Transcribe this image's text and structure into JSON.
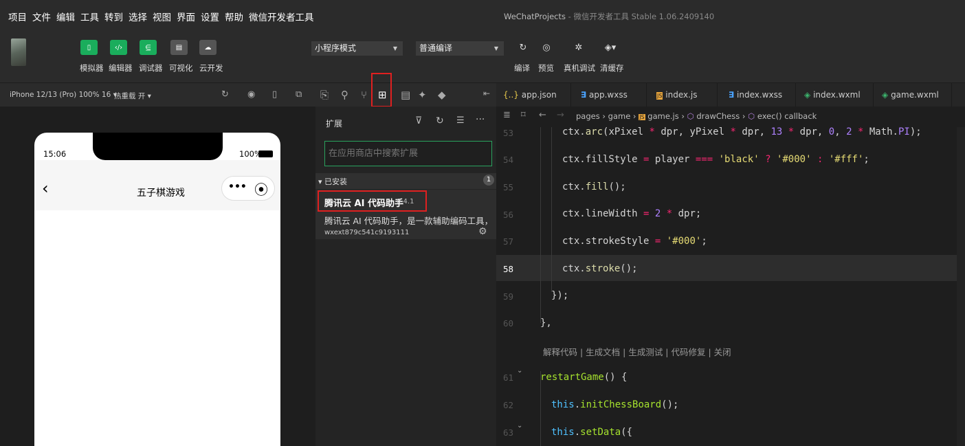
{
  "menu": [
    "项目",
    "文件",
    "编辑",
    "工具",
    "转到",
    "选择",
    "视图",
    "界面",
    "设置",
    "帮助",
    "微信开发者工具"
  ],
  "window_title": "WeChatProjects",
  "window_title_sub": " - 微信开发者工具 Stable 1.06.2409140",
  "toolbar": {
    "btns": [
      {
        "label": "模拟器",
        "icon": "phone-icon"
      },
      {
        "label": "编辑器",
        "icon": "code-icon"
      },
      {
        "label": "调试器",
        "icon": "debug-icon"
      },
      {
        "label": "可视化",
        "icon": "layout-icon"
      },
      {
        "label": "云开发",
        "icon": "cloud-icon"
      }
    ],
    "mode": "小程序模式",
    "compile": "普通编译",
    "actions": [
      {
        "label": "编译",
        "icon": "refresh-icon"
      },
      {
        "label": "预览",
        "icon": "eye-icon"
      },
      {
        "label": "真机调试",
        "icon": "bug-icon"
      },
      {
        "label": "清缓存",
        "icon": "layers-icon"
      }
    ]
  },
  "sim": {
    "device": "iPhone 12/13 (Pro) 100% 16 ▾",
    "hotreload": "热重载 开 ▾",
    "time": "15:06",
    "battery": "100%",
    "back": "‹",
    "page_title": "五子棋游戏",
    "more": "•••",
    "target": "⦿"
  },
  "ext": {
    "title": "扩展",
    "search_placeholder": "在应用商店中搜索扩展",
    "installed": "▾ 已安装",
    "installed_count": "1",
    "item": {
      "name": "腾讯云 AI 代码助手",
      "version": "0.4.1",
      "desc": "腾讯云 AI 代码助手，是一款辅助编码工具，...",
      "id": "wxext879c541c9193111"
    }
  },
  "editor": {
    "tabs": [
      {
        "icon": "{..}",
        "name": "app.json"
      },
      {
        "icon": "∃",
        "name": "app.wxss"
      },
      {
        "icon": "JS",
        "name": "index.js"
      },
      {
        "icon": "∃",
        "name": "index.wxss"
      },
      {
        "icon": "◈",
        "name": "index.wxml"
      },
      {
        "icon": "◈",
        "name": "game.wxml"
      }
    ],
    "breadcrumb": {
      "pages": "pages",
      "game": "game",
      "file": "game.js",
      "fn": "drawChess",
      "cb": "exec() callback"
    },
    "codelens": "解释代码 | 生成文档 | 生成测试 | 代码修复 | 关闭",
    "lines": [
      {
        "n": "53"
      },
      {
        "n": "54"
      },
      {
        "n": "55"
      },
      {
        "n": "56"
      },
      {
        "n": "57"
      },
      {
        "n": "58"
      },
      {
        "n": "59"
      },
      {
        "n": "60"
      },
      {
        "n": "61"
      },
      {
        "n": "62"
      },
      {
        "n": "63"
      }
    ]
  }
}
